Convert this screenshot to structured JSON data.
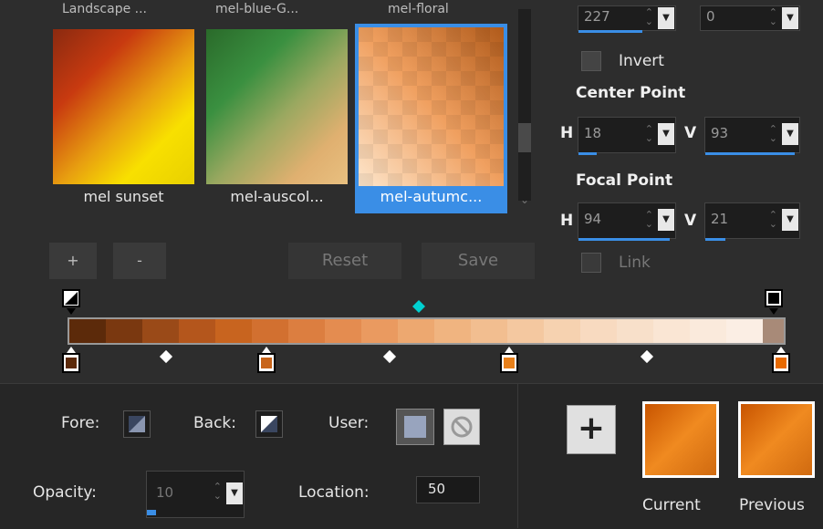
{
  "presets": {
    "top_row_labels": [
      "Landscape ...",
      "mel-blue-G...",
      "mel-floral"
    ],
    "items": [
      {
        "label": "mel sunset",
        "selected": false
      },
      {
        "label": "mel-auscol...",
        "selected": false
      },
      {
        "label": "mel-autumc...",
        "selected": true
      }
    ]
  },
  "angle_field": {
    "value": "227"
  },
  "repeats_field": {
    "value": "0"
  },
  "invert": {
    "label": "Invert",
    "checked": false
  },
  "center_point": {
    "title": "Center Point",
    "h_label": "H",
    "h_value": "18",
    "v_label": "V",
    "v_value": "93"
  },
  "focal_point": {
    "title": "Focal Point",
    "h_label": "H",
    "h_value": "94",
    "v_label": "V",
    "v_value": "21"
  },
  "link": {
    "label": "Link",
    "checked": false
  },
  "buttons": {
    "add": "+",
    "remove": "-",
    "reset": "Reset",
    "save": "Save"
  },
  "gradient": {
    "accent": "#00d0d0",
    "stops": [
      "#5c2a0a",
      "#c8641a",
      "#e8801a",
      "#e86a00"
    ]
  },
  "bottom": {
    "fore_label": "Fore:",
    "back_label": "Back:",
    "user_label": "User:",
    "opacity_label": "Opacity:",
    "opacity_value": "10",
    "location_label": "Location:",
    "location_value": "50",
    "add_label": "+",
    "current_label": "Current",
    "previous_label": "Previous"
  }
}
